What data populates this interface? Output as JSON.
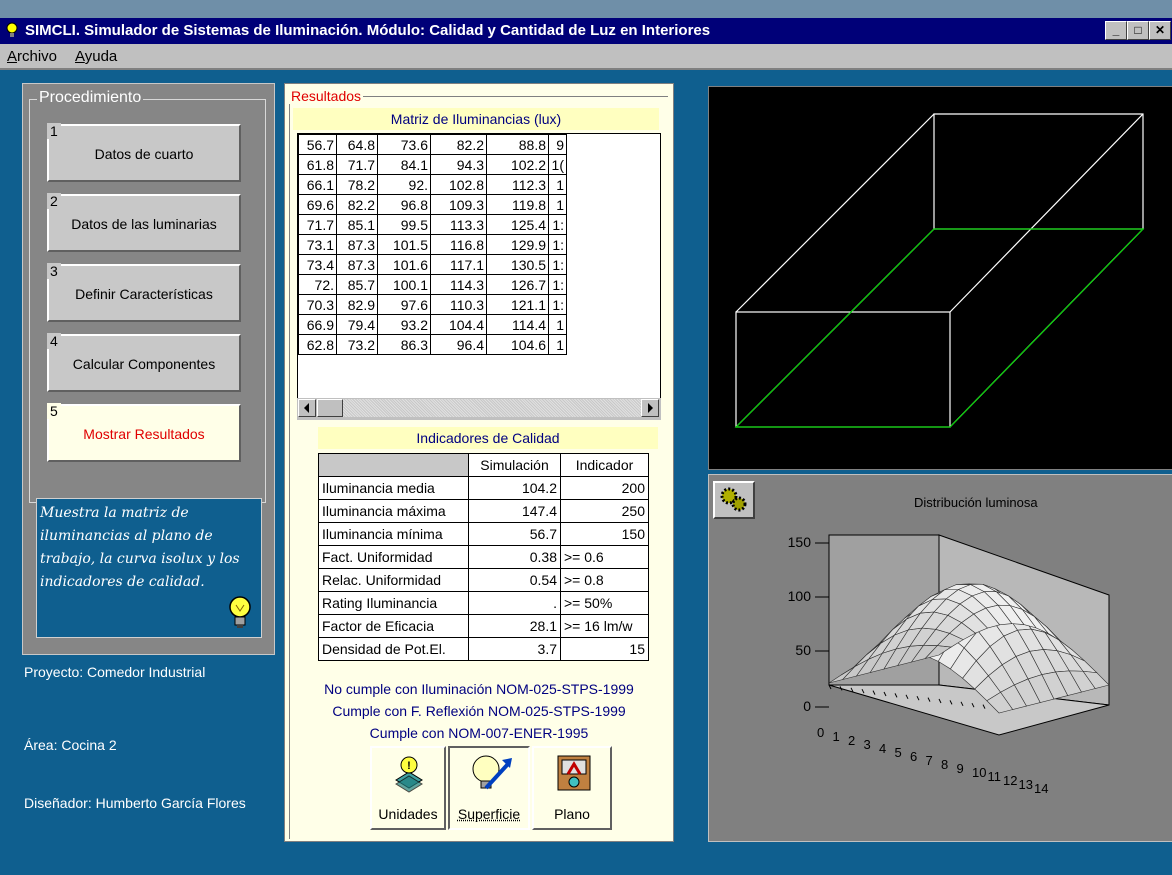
{
  "window": {
    "title": "SIMCLI. Simulador de Sistemas de Iluminación. Módulo: Calidad y Cantidad de Luz en Interiores"
  },
  "menu": {
    "archivo": "Archivo",
    "ayuda": "Ayuda"
  },
  "procedimiento": {
    "title": "Procedimiento",
    "steps": [
      {
        "num": "1",
        "label": "Datos de cuarto"
      },
      {
        "num": "2",
        "label": "Datos de las luminarias"
      },
      {
        "num": "3",
        "label": "Definir Características"
      },
      {
        "num": "4",
        "label": "Calcular Componentes"
      },
      {
        "num": "5",
        "label": "Mostrar Resultados"
      }
    ],
    "help_text": "Muestra la matriz de iluminancias al plano de trabajo, la curva isolux y los indicadores de calidad."
  },
  "project": {
    "proyecto": "Proyecto: Comedor Industrial",
    "area": "Área: Cocina 2",
    "disenador": "Diseñador: Humberto García Flores"
  },
  "results": {
    "title": "Resultados",
    "matrix_title": "Matriz de Iluminancias (lux)",
    "matrix": [
      [
        "56.7",
        "64.8",
        "73.6",
        "82.2",
        "88.8",
        "9"
      ],
      [
        "61.8",
        "71.7",
        "84.1",
        "94.3",
        "102.2",
        "1("
      ],
      [
        "66.1",
        "78.2",
        "92.",
        "102.8",
        "112.3",
        "1"
      ],
      [
        "69.6",
        "82.2",
        "96.8",
        "109.3",
        "119.8",
        "1"
      ],
      [
        "71.7",
        "85.1",
        "99.5",
        "113.3",
        "125.4",
        "1:"
      ],
      [
        "73.1",
        "87.3",
        "101.5",
        "116.8",
        "129.9",
        "1:"
      ],
      [
        "73.4",
        "87.3",
        "101.6",
        "117.1",
        "130.5",
        "1:"
      ],
      [
        "72.",
        "85.7",
        "100.1",
        "114.3",
        "126.7",
        "1:"
      ],
      [
        "70.3",
        "82.9",
        "97.6",
        "110.3",
        "121.1",
        "1:"
      ],
      [
        "66.9",
        "79.4",
        "93.2",
        "104.4",
        "114.4",
        "1"
      ],
      [
        "62.8",
        "73.2",
        "86.3",
        "96.4",
        "104.6",
        "1"
      ]
    ],
    "indicators_title": "Indicadores de Calidad",
    "indicators_header": [
      "",
      "Simulación",
      "Indicador"
    ],
    "indicators": [
      [
        "Iluminancia media",
        "104.2",
        "200"
      ],
      [
        "Iluminancia máxima",
        "147.4",
        "250"
      ],
      [
        "Iluminancia mínima",
        "56.7",
        "150"
      ],
      [
        "Fact. Uniformidad",
        "0.38",
        ">= 0.6"
      ],
      [
        "Relac. Uniformidad",
        "0.54",
        ">= 0.8"
      ],
      [
        "Rating Iluminancia",
        ".",
        ">= 50%"
      ],
      [
        "Factor de Eficacia",
        "28.1",
        ">= 16 lm/w"
      ],
      [
        "Densidad de Pot.El.",
        "3.7",
        "15"
      ]
    ],
    "compliance": [
      "No cumple con Iluminación NOM-025-STPS-1999",
      "Cumple con F. Reflexión NOM-025-STPS-1999",
      "Cumple con NOM-007-ENER-1995"
    ],
    "buttons": {
      "unidades": "Unidades",
      "superficie": "Superficie",
      "plano": "Plano"
    }
  },
  "chart_data": {
    "type": "surface",
    "title": "Distribución luminosa",
    "z_ticks": [
      "0",
      "50",
      "100",
      "150"
    ],
    "x_ticks": [
      "0",
      "1",
      "2",
      "3",
      "4",
      "5",
      "6",
      "7",
      "8",
      "9",
      "10",
      "11",
      "12",
      "13",
      "14"
    ]
  }
}
